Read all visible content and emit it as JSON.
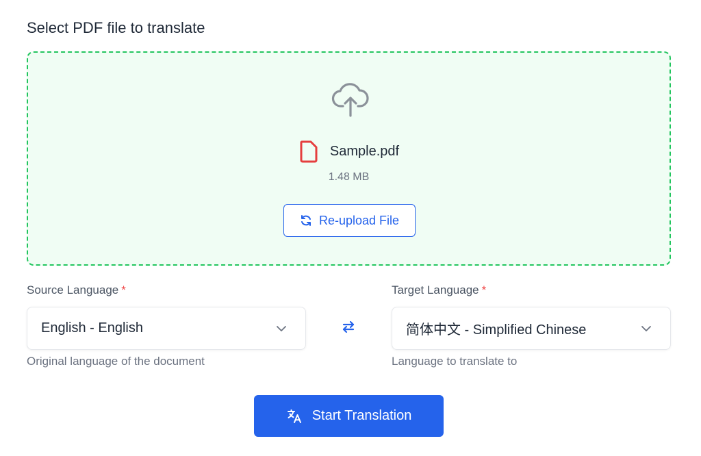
{
  "upload": {
    "section_title": "Select PDF file to translate",
    "file_name": "Sample.pdf",
    "file_size": "1.48 MB",
    "reupload_label": "Re-upload File",
    "icons": [
      "cloud-upload-icon",
      "pdf-file-icon",
      "refresh-icon"
    ]
  },
  "source": {
    "label": "Source Language",
    "required_mark": "*",
    "value": "English - English",
    "helper": "Original language of the document",
    "icon": "chevron-down-icon"
  },
  "target": {
    "label": "Target Language",
    "required_mark": "*",
    "value": "简体中文 - Simplified Chinese",
    "helper": "Language to translate to",
    "icon": "chevron-down-icon"
  },
  "swap": {
    "icon": "swap-arrows-icon"
  },
  "action": {
    "start_label": "Start Translation",
    "icon": "translate-icon"
  },
  "colors": {
    "primary": "#2563eb",
    "dropzone_bg": "#f0fdf4",
    "dropzone_border": "#22c55e",
    "required": "#ef4444",
    "pdf_icon": "#e53e3e"
  }
}
